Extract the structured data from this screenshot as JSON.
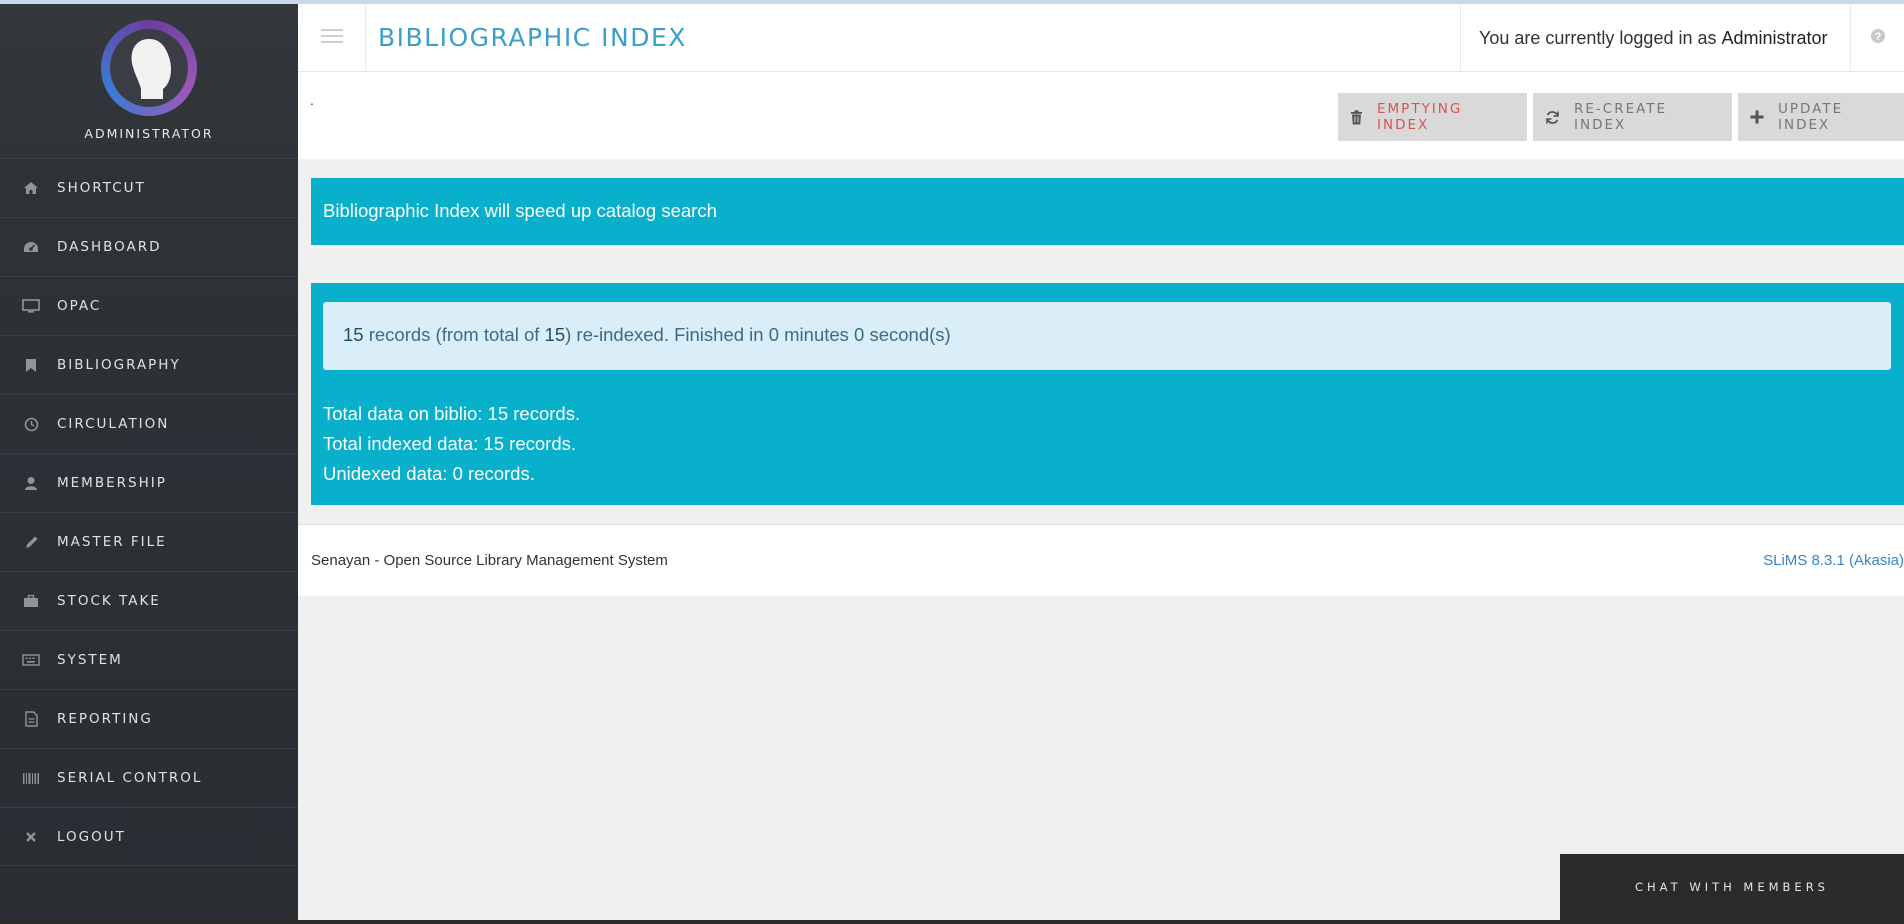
{
  "user": {
    "display_name": "ADMINISTRATOR"
  },
  "sidebar": {
    "items": [
      {
        "label": "SHORTCUT",
        "icon": "home-icon"
      },
      {
        "label": "DASHBOARD",
        "icon": "dashboard-icon"
      },
      {
        "label": "OPAC",
        "icon": "monitor-icon"
      },
      {
        "label": "BIBLIOGRAPHY",
        "icon": "bookmark-icon"
      },
      {
        "label": "CIRCULATION",
        "icon": "clock-icon"
      },
      {
        "label": "MEMBERSHIP",
        "icon": "user-icon"
      },
      {
        "label": "MASTER FILE",
        "icon": "pencil-icon"
      },
      {
        "label": "STOCK TAKE",
        "icon": "briefcase-icon"
      },
      {
        "label": "SYSTEM",
        "icon": "keyboard-icon"
      },
      {
        "label": "REPORTING",
        "icon": "file-icon"
      },
      {
        "label": "SERIAL CONTROL",
        "icon": "barcode-icon"
      },
      {
        "label": "LOGOUT",
        "icon": "close-icon"
      }
    ]
  },
  "header": {
    "title": "BIBLIOGRAPHIC INDEX",
    "login_prefix": "You are currently logged in as",
    "login_user": "Administrator"
  },
  "actions": {
    "dot": ".",
    "emptying": "EMPTYING INDEX",
    "recreate": "RE-CREATE INDEX",
    "update": "UPDATE INDEX"
  },
  "info": {
    "message": "Bibliographic Index will speed up catalog search"
  },
  "result": {
    "count": "15",
    "text_a": "records (from total of",
    "total": "15",
    "text_b": ") re-indexed. Finished in 0 minutes 0 second(s)",
    "stats": [
      "Total data on biblio: 15 records.",
      "Total indexed data: 15 records.",
      "Unidexed data: 0 records."
    ]
  },
  "footer": {
    "left": "Senayan - Open Source Library Management System",
    "right": "SLiMS 8.3.1 (Akasia)"
  },
  "chat": {
    "label": "CHAT WITH MEMBERS"
  },
  "colors": {
    "accent": "#08b0cc",
    "title": "#3aa0c9",
    "danger": "#d9534f",
    "sidebar": "#2f3338"
  }
}
